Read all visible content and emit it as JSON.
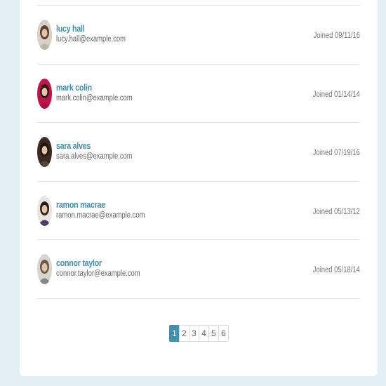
{
  "users": [
    {
      "name": "lucy hall",
      "email": "lucy.hall@example.com",
      "joined": "Joined 09/11/16",
      "avatar_icon": "person-photo",
      "colors": {
        "bg": "#d8cfc5",
        "hair": "#5a4030",
        "shirt": "#bdb4a8"
      }
    },
    {
      "name": "mark colin",
      "email": "mark.colin@example.com",
      "joined": "Joined 01/14/14",
      "avatar_icon": "person-photo",
      "colors": {
        "bg": "#c1124a",
        "hair": "#2a1a15",
        "shirt": "#a8103e"
      }
    },
    {
      "name": "sara alves",
      "email": "sara.alves@example.com",
      "joined": "Joined 07/19/16",
      "avatar_icon": "person-photo",
      "colors": {
        "bg": "#3a2a22",
        "hair": "#1e140e",
        "shirt": "#5a4638"
      }
    },
    {
      "name": "ramon macrae",
      "email": "ramon.macrae@example.com",
      "joined": "Joined 05/13/12",
      "avatar_icon": "person-photo",
      "colors": {
        "bg": "#e8e4e0",
        "hair": "#2b1d15",
        "shirt": "#4a3a6a"
      }
    },
    {
      "name": "connor taylor",
      "email": "connor.taylor@example.com",
      "joined": "Joined 05/18/14",
      "avatar_icon": "person-photo",
      "colors": {
        "bg": "#d8d4cf",
        "hair": "#6b5a48",
        "shirt": "#8a8680"
      }
    }
  ],
  "pagination": {
    "pages": [
      "1",
      "2",
      "3",
      "4",
      "5",
      "6"
    ],
    "current": "1"
  },
  "theme": {
    "accent": "#3f8fae",
    "page_bg": "#e3eef5"
  }
}
